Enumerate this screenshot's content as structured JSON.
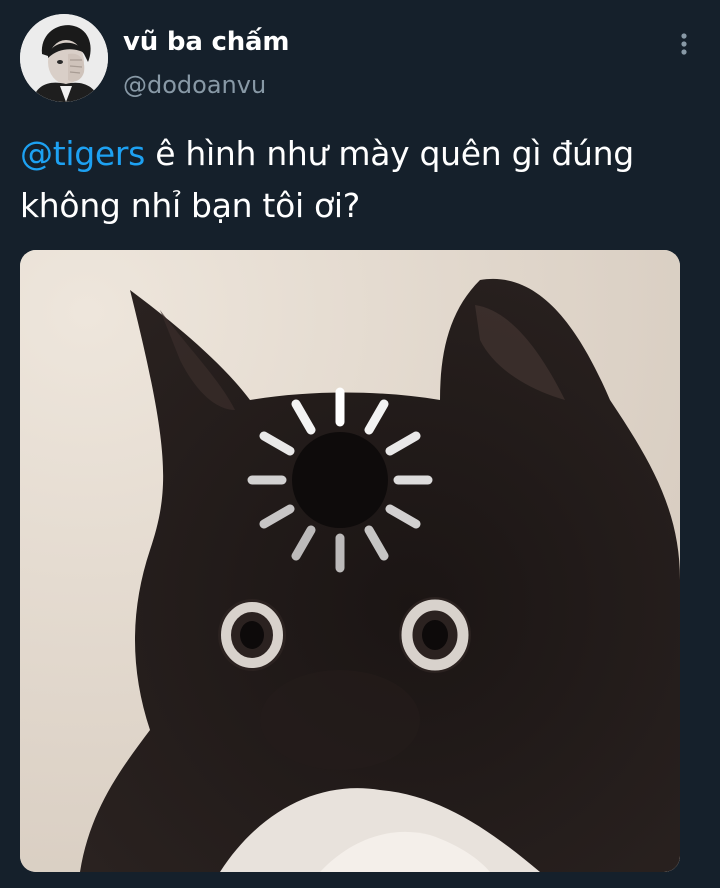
{
  "user": {
    "display_name": "vũ ba chấm",
    "handle": "@dodoanvu",
    "avatar_icon": "profile-photo"
  },
  "tweet": {
    "mention": "@tigers",
    "text": " ê hình như mày quên gì đúng không nhỉ bạn tôi ơi?"
  },
  "media": {
    "subject": "cat-meme",
    "overlay_icon": "loading-spinner-icon"
  },
  "menu_icon": "more-vertical-icon",
  "colors": {
    "background": "#15202b",
    "text": "#ffffff",
    "secondary": "#8899a6",
    "accent": "#1da1f2"
  }
}
